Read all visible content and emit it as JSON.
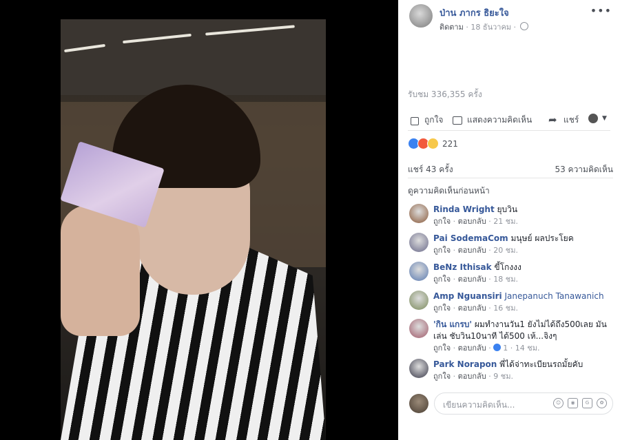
{
  "post": {
    "author": "ป่าน ภากร ธิยะใจ",
    "follow_label": "ติดตาม",
    "separator": " · ",
    "date": "18 ธันวาคม",
    "more_label": "•••",
    "views": "รับชม 336,355 ครั้ง"
  },
  "actions": {
    "like": "ถูกใจ",
    "comment": "แสดงความคิดเห็น",
    "share": "แชร์"
  },
  "reactions": {
    "count": "221",
    "types": [
      "like",
      "angry",
      "sad"
    ]
  },
  "stats": {
    "shares": "แชร์ 43 ครั้ง",
    "comments": "53 ความคิดเห็น"
  },
  "view_previous": "ดูความคิดเห็นก่อนหน้า",
  "comments": [
    {
      "name": "Rinda Wright",
      "text": "ยุบวิน",
      "like": "ถูกใจ",
      "reply": "ตอบกลับ",
      "time": "21 ชม.",
      "avatar_color": "#8a5a3a"
    },
    {
      "name": "Pai SodemaCom",
      "text": "มนุษย์ ผลประโยค",
      "like": "ถูกใจ",
      "reply": "ตอบกลับ",
      "time": "20 ชม.",
      "avatar_color": "#6a6a8a"
    },
    {
      "name": "BeNz Ithisak",
      "text": "ขี้โกงงง",
      "like": "ถูกใจ",
      "reply": "ตอบกลับ",
      "time": "18 ชม.",
      "avatar_color": "#5a7ab0"
    },
    {
      "name": "Amp Nguansiri",
      "text": "Janepanuch Tanawanich",
      "text_is_tag": true,
      "like": "ถูกใจ",
      "reply": "ตอบกลับ",
      "time": "16 ชม.",
      "avatar_color": "#7a8a5a"
    },
    {
      "name": "'กิน แกรบ'",
      "text": "ผมทำงานวัน1 ยังไม่ได้ถึง500เลย มันเล่น ชับวิน10นาที ได้500 เห้...จิงๆ",
      "like": "ถูกใจ",
      "reply": "ตอบกลับ",
      "likes": "1",
      "time": "14 ชม.",
      "avatar_color": "#a05a6a"
    },
    {
      "name": "Park Norapon",
      "text": "พี่ได้จ่าทะเบียนรถมั้ยคับ",
      "like": "ถูกใจ",
      "reply": "ตอบกลับ",
      "time": "9 ชม.",
      "avatar_color": "#3a3a4a"
    }
  ],
  "composer": {
    "placeholder": "เขียนความคิดเห็น..."
  }
}
